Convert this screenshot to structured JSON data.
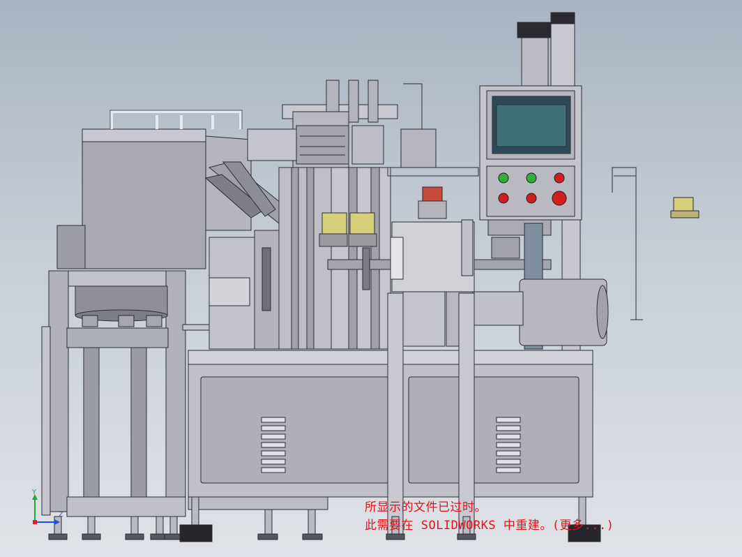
{
  "viewport": {
    "background_top": "#a9b4c0",
    "background_bottom": "#dfe3e8"
  },
  "message": {
    "line1": "所显示的文件已过时。",
    "line2": "此需要在 SOLIDWORKS 中重建。(更多...)",
    "color": "#e0141c"
  },
  "triad": {
    "y_label": "Y",
    "z_label": "Z"
  },
  "machine": {
    "body_color": "#b9bac2",
    "outline_color": "#2c2c33",
    "screen_color": "#3e6f74",
    "green_button_color": "#2fae3a",
    "red_button_color": "#d21e1e"
  }
}
